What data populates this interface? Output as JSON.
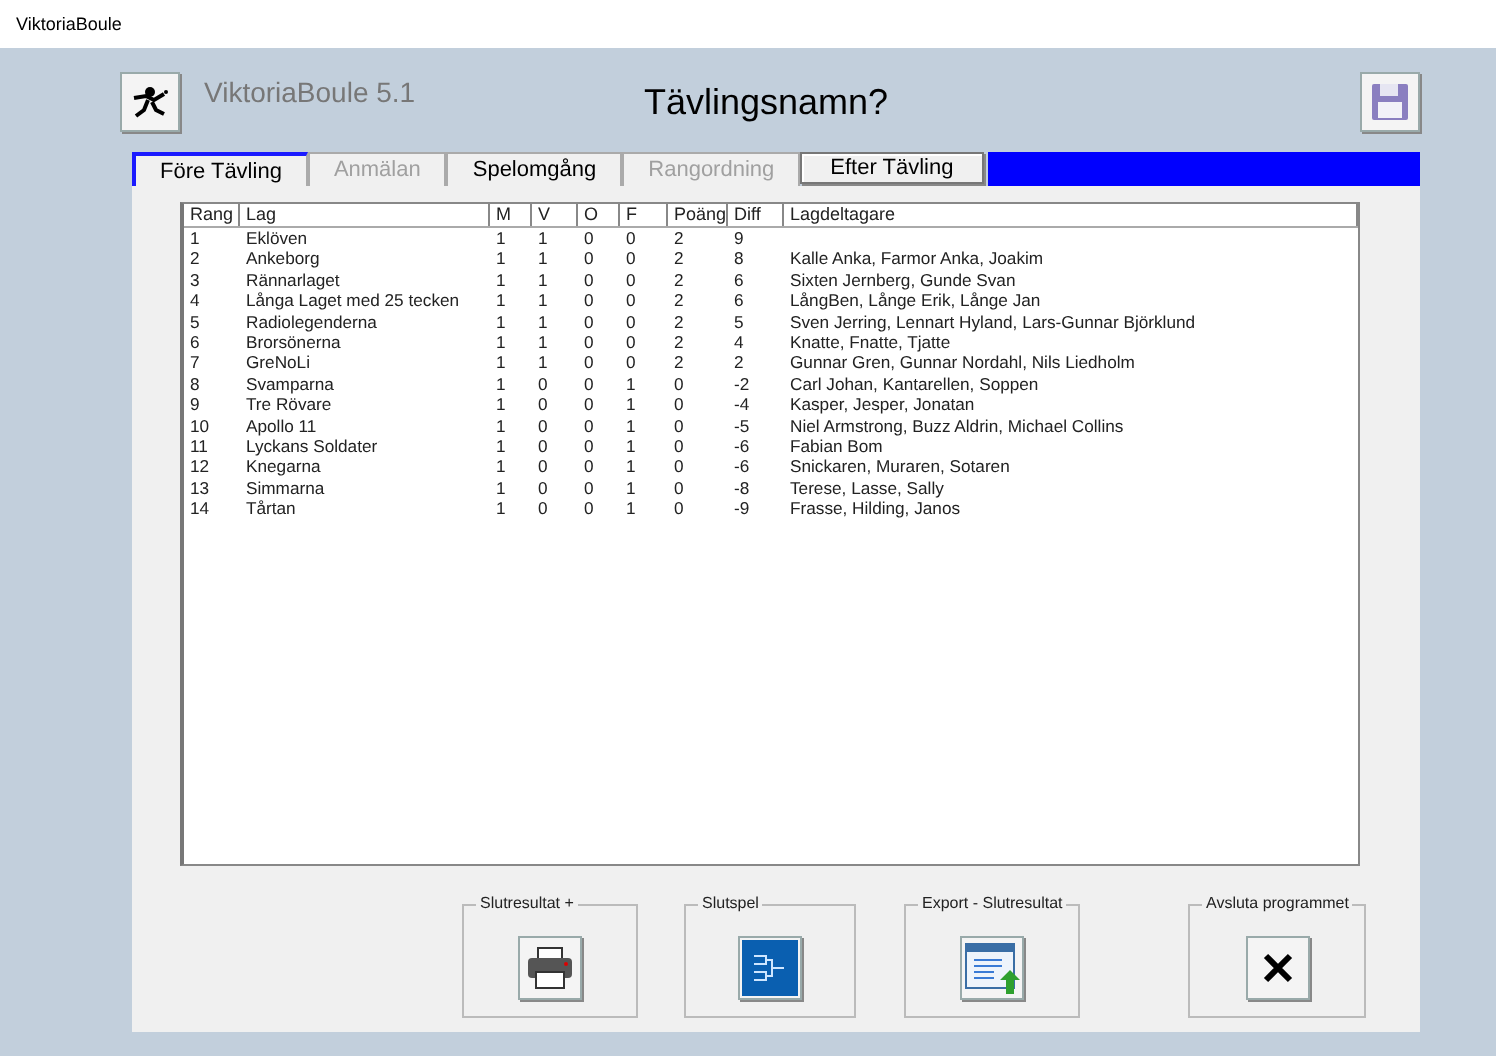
{
  "window": {
    "title": "ViktoriaBoule"
  },
  "header": {
    "app_name": "ViktoriaBoule 5.1",
    "competition_name": "Tävlingsnamn?"
  },
  "tabs": [
    {
      "label": "Före Tävling",
      "selected": true,
      "disabled": false,
      "highlighted": false
    },
    {
      "label": "Anmälan",
      "selected": false,
      "disabled": true,
      "highlighted": false
    },
    {
      "label": "Spelomgång",
      "selected": false,
      "disabled": false,
      "highlighted": false
    },
    {
      "label": "Rangordning",
      "selected": false,
      "disabled": true,
      "highlighted": false
    },
    {
      "label": "Efter Tävling",
      "selected": false,
      "disabled": false,
      "highlighted": true
    }
  ],
  "table": {
    "columns": [
      "Rang",
      "Lag",
      "M",
      "V",
      "O",
      "F",
      "Poäng",
      "Diff",
      "Lagdeltagare"
    ],
    "rows": [
      [
        "1",
        "Eklöven",
        "1",
        "1",
        "0",
        "0",
        "2",
        "9",
        ""
      ],
      [
        "2",
        "Ankeborg",
        "1",
        "1",
        "0",
        "0",
        "2",
        "8",
        "Kalle Anka, Farmor Anka, Joakim"
      ],
      [
        "3",
        "Rännarlaget",
        "1",
        "1",
        "0",
        "0",
        "2",
        "6",
        "Sixten Jernberg, Gunde Svan"
      ],
      [
        "4",
        "Långa Laget med 25 tecken",
        "1",
        "1",
        "0",
        "0",
        "2",
        "6",
        "LångBen, Långe Erik, Långe Jan"
      ],
      [
        "5",
        "Radiolegenderna",
        "1",
        "1",
        "0",
        "0",
        "2",
        "5",
        "Sven Jerring, Lennart Hyland, Lars-Gunnar Björklund"
      ],
      [
        "6",
        "Brorsönerna",
        "1",
        "1",
        "0",
        "0",
        "2",
        "4",
        "Knatte, Fnatte, Tjatte"
      ],
      [
        "7",
        "GreNoLi",
        "1",
        "1",
        "0",
        "0",
        "2",
        "2",
        "Gunnar Gren, Gunnar Nordahl, Nils Liedholm"
      ],
      [
        "8",
        "Svamparna",
        "1",
        "0",
        "0",
        "1",
        "0",
        "-2",
        "Carl Johan, Kantarellen, Soppen"
      ],
      [
        "9",
        "Tre Rövare",
        "1",
        "0",
        "0",
        "1",
        "0",
        "-4",
        "Kasper, Jesper, Jonatan"
      ],
      [
        "10",
        "Apollo 11",
        "1",
        "0",
        "0",
        "1",
        "0",
        "-5",
        "Niel Armstrong, Buzz Aldrin, Michael Collins"
      ],
      [
        "11",
        "Lyckans Soldater",
        "1",
        "0",
        "0",
        "1",
        "0",
        "-6",
        "Fabian Bom"
      ],
      [
        "12",
        "Knegarna",
        "1",
        "0",
        "0",
        "1",
        "0",
        "-6",
        "Snickaren, Muraren, Sotaren"
      ],
      [
        "13",
        "Simmarna",
        "1",
        "0",
        "0",
        "1",
        "0",
        "-8",
        "Terese, Lasse, Sally"
      ],
      [
        "14",
        "Tårtan",
        "1",
        "0",
        "0",
        "1",
        "0",
        "-9",
        "Frasse, Hilding, Janos"
      ]
    ]
  },
  "actions": [
    {
      "label": "Slutresultat +",
      "kind": "print"
    },
    {
      "label": "Slutspel",
      "kind": "bracket"
    },
    {
      "label": "Export - Slutresultat",
      "kind": "export"
    },
    {
      "label": "Avsluta programmet",
      "kind": "exit"
    }
  ]
}
